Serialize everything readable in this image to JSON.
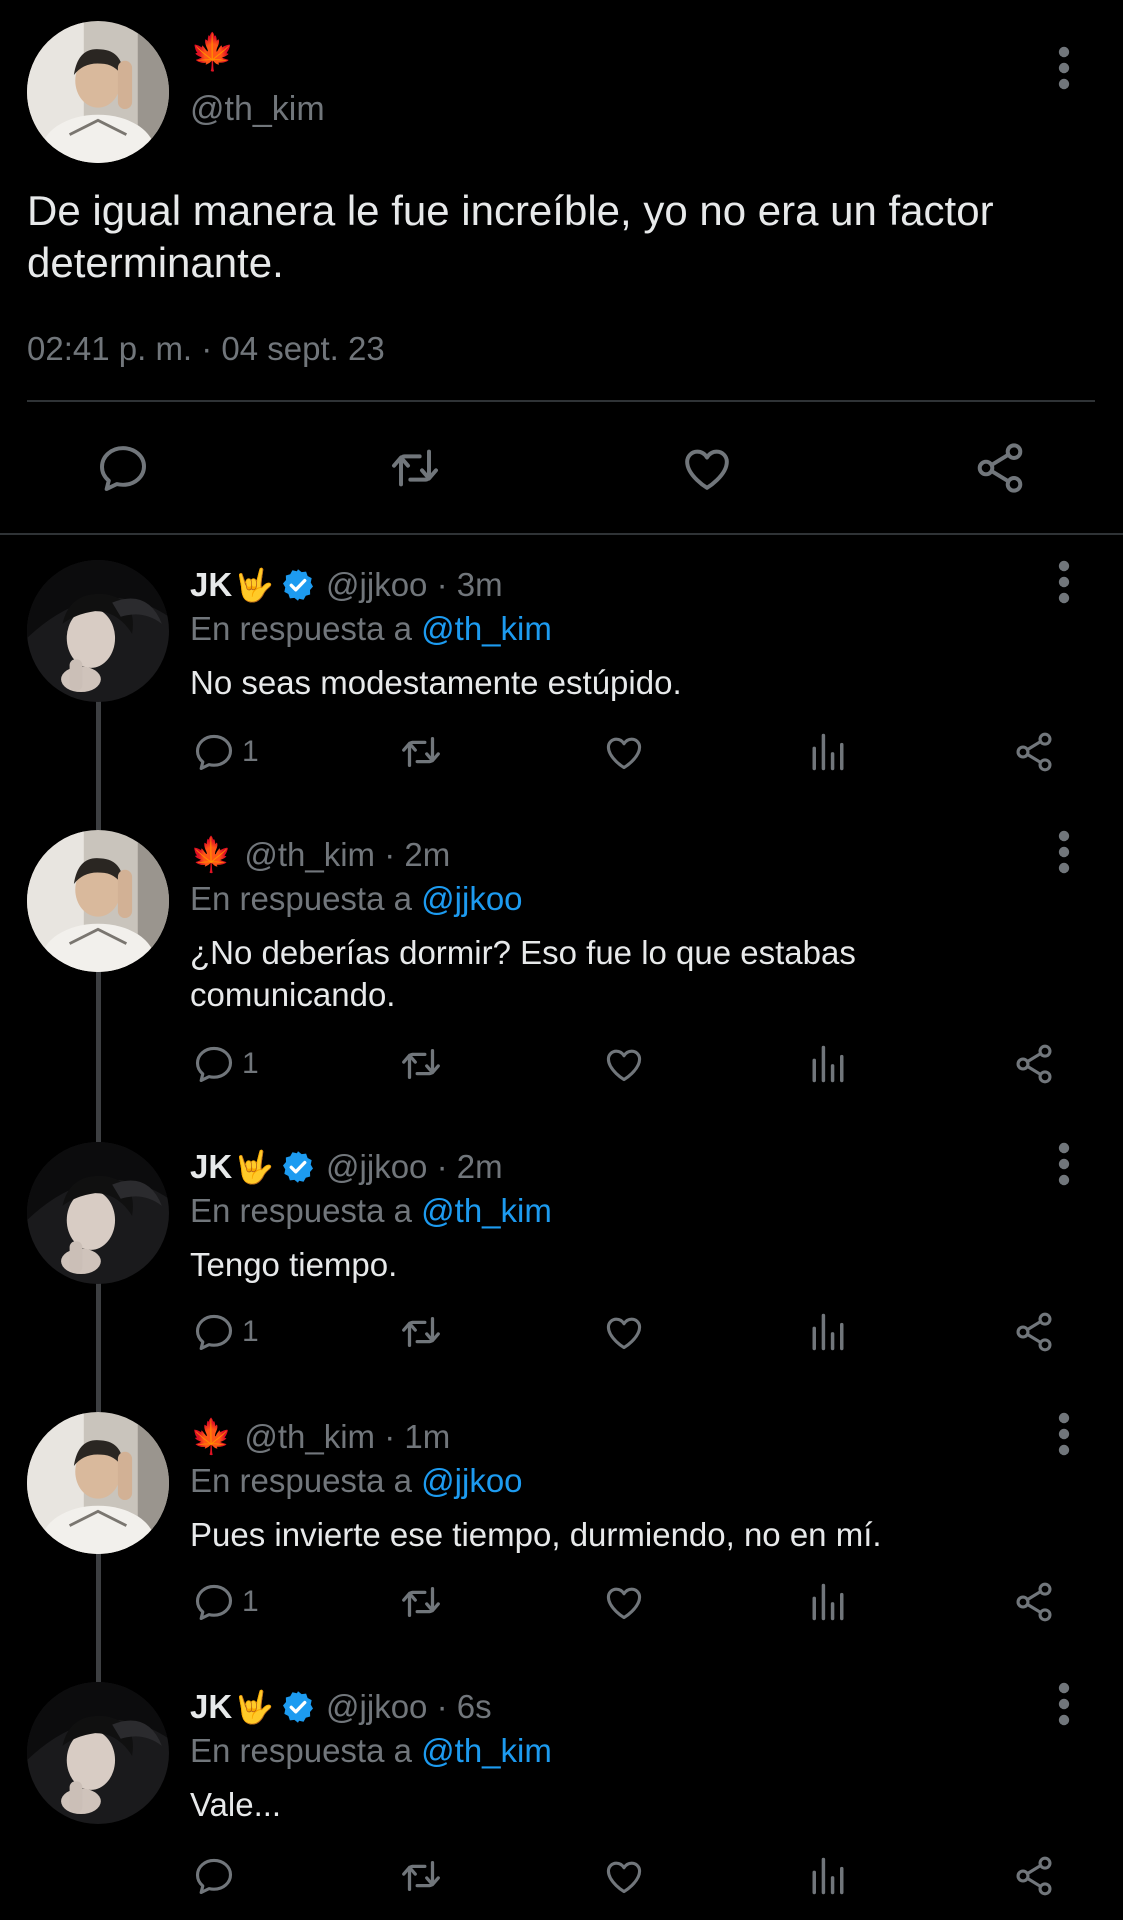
{
  "main_tweet": {
    "emoji": "🍁",
    "handle": "@th_kim",
    "text": "De igual manera le fue increíble, yo no era un factor determinante.",
    "timestamp": "02:41 p. m. · 04 sept. 23",
    "icons": [
      "reply-icon",
      "retweet-icon",
      "like-icon",
      "share-icon"
    ]
  },
  "replies": [
    {
      "display_name": "JK",
      "name_emoji": "🤟",
      "verified": true,
      "handle_time": "@jjkoo · 3m",
      "reply_prefix": "En respuesta a ",
      "mention": "@th_kim",
      "text": "No seas modestamente estúpido.",
      "reply_count": "1"
    },
    {
      "leaf_emoji": "🍁",
      "handle_time": "@th_kim · 2m",
      "reply_prefix": "En respuesta a ",
      "mention": "@jjkoo",
      "text": "¿No deberías dormir? Eso fue lo que estabas comunicando.",
      "reply_count": "1"
    },
    {
      "display_name": "JK",
      "name_emoji": "🤟",
      "verified": true,
      "handle_time": "@jjkoo · 2m",
      "reply_prefix": "En respuesta a ",
      "mention": "@th_kim",
      "text": "Tengo tiempo.",
      "reply_count": "1"
    },
    {
      "leaf_emoji": "🍁",
      "handle_time": "@th_kim · 1m",
      "reply_prefix": "En respuesta a ",
      "mention": "@jjkoo",
      "text": "Pues invierte ese tiempo, durmiendo, no en mí.",
      "reply_count": "1"
    },
    {
      "display_name": "JK",
      "name_emoji": "🤟",
      "verified": true,
      "handle_time": "@jjkoo · 6s",
      "reply_prefix": "En respuesta a ",
      "mention": "@th_kim",
      "text": "Vale...",
      "reply_count": ""
    }
  ],
  "colors": {
    "background": "#000000",
    "text": "#e7e9ea",
    "muted": "#71767b",
    "link": "#1d9bf0",
    "verified": "#1d9bf0",
    "divider": "#2f3336"
  }
}
